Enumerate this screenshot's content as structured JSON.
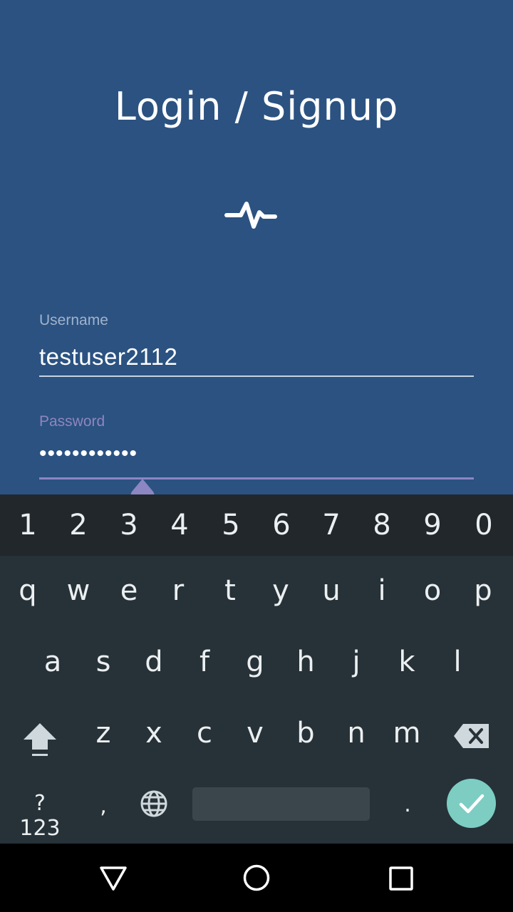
{
  "screen": {
    "title": "Login / Signup",
    "logo_icon": "pulse-icon"
  },
  "form": {
    "username": {
      "label": "Username",
      "value": "testuser2112"
    },
    "password": {
      "label": "Password",
      "value": "••••••••••••"
    }
  },
  "keyboard": {
    "numbers": [
      "1",
      "2",
      "3",
      "4",
      "5",
      "6",
      "7",
      "8",
      "9",
      "0"
    ],
    "row1": [
      "q",
      "w",
      "e",
      "r",
      "t",
      "y",
      "u",
      "i",
      "o",
      "p"
    ],
    "row2": [
      "a",
      "s",
      "d",
      "f",
      "g",
      "h",
      "j",
      "k",
      "l"
    ],
    "row3": [
      "z",
      "x",
      "c",
      "v",
      "b",
      "n",
      "m"
    ],
    "symbols_label": "?123",
    "comma": ",",
    "period": ".",
    "icons": {
      "shift": "shift-icon",
      "backspace": "backspace-icon",
      "language": "globe-icon",
      "enter": "check-icon"
    }
  },
  "colors": {
    "background": "#2b5281",
    "accent": "#8c86c3",
    "keyboard": "#263238",
    "enter": "#7dcdc3"
  },
  "navbar": {
    "icons": [
      "back-icon",
      "home-icon",
      "recents-icon"
    ]
  }
}
